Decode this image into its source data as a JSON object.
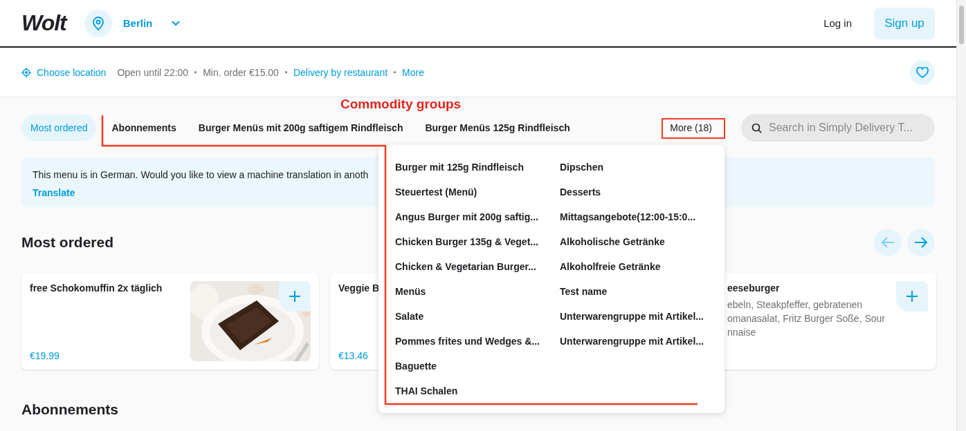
{
  "header": {
    "logo": "Wolt",
    "city": "Berlin",
    "login": "Log in",
    "signup": "Sign up"
  },
  "info_bar": {
    "items": [
      {
        "kind": "location",
        "label": "Choose location"
      },
      {
        "kind": "text",
        "label": "Open until 22:00"
      },
      {
        "kind": "text",
        "label": "Min. order €15.00"
      },
      {
        "kind": "link",
        "label": "Delivery by restaurant"
      },
      {
        "kind": "link",
        "label": "More"
      }
    ]
  },
  "annotation": {
    "label": "Commodity groups"
  },
  "category_tabs": [
    {
      "label": "Most ordered",
      "selected": true
    },
    {
      "label": "Abonnements",
      "selected": false
    },
    {
      "label": "Burger Menüs mit 200g saftigem Rindfleisch",
      "selected": false
    },
    {
      "label": "Burger Menüs 125g Rindfleisch",
      "selected": false
    }
  ],
  "more_button": {
    "label": "More (18)"
  },
  "search": {
    "placeholder": "Search in Simply Delivery T..."
  },
  "more_menu": [
    "Burger mit 125g Rindfleisch",
    "Steuertest (Menü)",
    "Angus Burger mit 200g saftig...",
    "Chicken Burger 135g & Veget...",
    "Chicken & Vegetarian Burger...",
    "Menüs",
    "Salate",
    "Pommes frites und Wedges &...",
    "Baguette",
    "THAI Schalen",
    "Dipschen",
    "Desserts",
    "Mittagsangebote(12:00-15:0...",
    "Alkoholische Getränke",
    "Alkoholfreie Getränke",
    "Test name",
    "Unterwarengruppe mit Artikel...",
    "Unterwarengruppe mit Artikel..."
  ],
  "translation_banner": {
    "text": "This menu is in German. Would you like to view a machine translation in anoth",
    "action": "Translate"
  },
  "sections": [
    {
      "title": "Most ordered",
      "arrows": [
        {
          "kind": "previous",
          "disabled": true
        },
        {
          "kind": "next",
          "disabled": false
        }
      ],
      "items": [
        {
          "kind": "picture",
          "name": "free Schokomuffin 2x täglich",
          "price": "€19.99"
        },
        {
          "kind": "covered_right",
          "name": "Veggie B",
          "price": "€13.46"
        },
        {
          "kind": "covered_left",
          "name": "eeseburger",
          "description_lines": [
            "ebeln, Steakpfeffer, gebratenen",
            "omanasalat, Fritz Burger Soße, Sour",
            "nnaise"
          ]
        }
      ]
    },
    {
      "title": "Abonnements"
    }
  ]
}
